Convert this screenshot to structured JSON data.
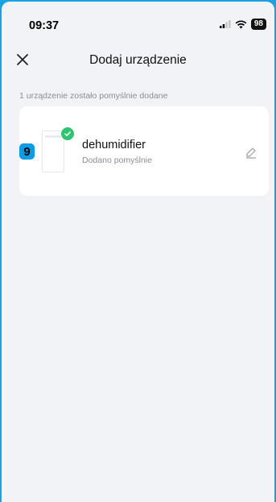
{
  "status_bar": {
    "time": "09:37",
    "battery": "98"
  },
  "header": {
    "title": "Dodaj urządzenie"
  },
  "main": {
    "info_text": "1 urządzenie zostało pomyślnie dodane",
    "device": {
      "badge_number": "9",
      "name": "dehumidifier",
      "status": "Dodano pomyślnie"
    }
  },
  "colors": {
    "frame": "#1aa3e0",
    "success": "#2ec472",
    "badge": "#0a9de6"
  },
  "icons": [
    "close-icon",
    "check-icon",
    "edit-icon",
    "signal-icon",
    "wifi-icon",
    "battery-icon"
  ]
}
